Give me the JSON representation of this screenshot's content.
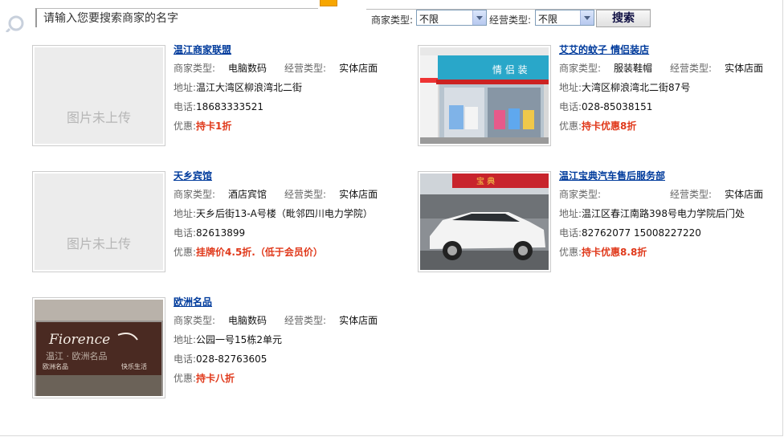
{
  "search": {
    "placeholder": "请输入您要搜索商家的名字",
    "merchant_type_label": "商家类型:",
    "merchant_type_value": "不限",
    "operation_type_label": "经营类型:",
    "operation_type_value": "不限",
    "button_label": "搜索"
  },
  "labels": {
    "merchant_type": "商家类型:",
    "operation_type": "经营类型:",
    "address": "地址:",
    "phone": "电话:",
    "discount": "优惠:",
    "no_image": "图片未上传"
  },
  "merchants": [
    {
      "name": "温江商家联盟",
      "merchant_type": "电脑数码",
      "operation_type": "实体店面",
      "address": "温江大湾区柳浪湾北二街",
      "phone": "18683333521",
      "discount": "持卡1折",
      "image": "none"
    },
    {
      "name": "艾艾的蚊子 情侣装店",
      "merchant_type": "服装鞋帽",
      "operation_type": "实体店面",
      "address": "大湾区柳浪湾北二街87号",
      "phone": "028-85038151",
      "discount": "持卡优惠8折",
      "image": "clothing-storefront-photo"
    },
    {
      "name": "天乡宾馆",
      "merchant_type": "酒店宾馆",
      "operation_type": "实体店面",
      "address": "天乡后街13-A号楼（毗邻四川电力学院）",
      "phone": "82613899",
      "discount": "挂牌价4.5折.（低于会员价）",
      "image": "none"
    },
    {
      "name": "温江宝典汽车售后服务部",
      "merchant_type": "",
      "operation_type": "实体店面",
      "address": "温江区春江南路398号电力学院后门处",
      "phone": "82762077 15008227220",
      "discount": "持卡优惠8.8折",
      "image": "white-suv-photo"
    },
    {
      "name": "欧洲名品",
      "merchant_type": "电脑数码",
      "operation_type": "实体店面",
      "address": "公园一号15栋2单元",
      "phone": "028-82763605",
      "discount": "持卡八折",
      "image": "fiorence-sign-photo",
      "image_sign_text": "Fiorence"
    }
  ]
}
